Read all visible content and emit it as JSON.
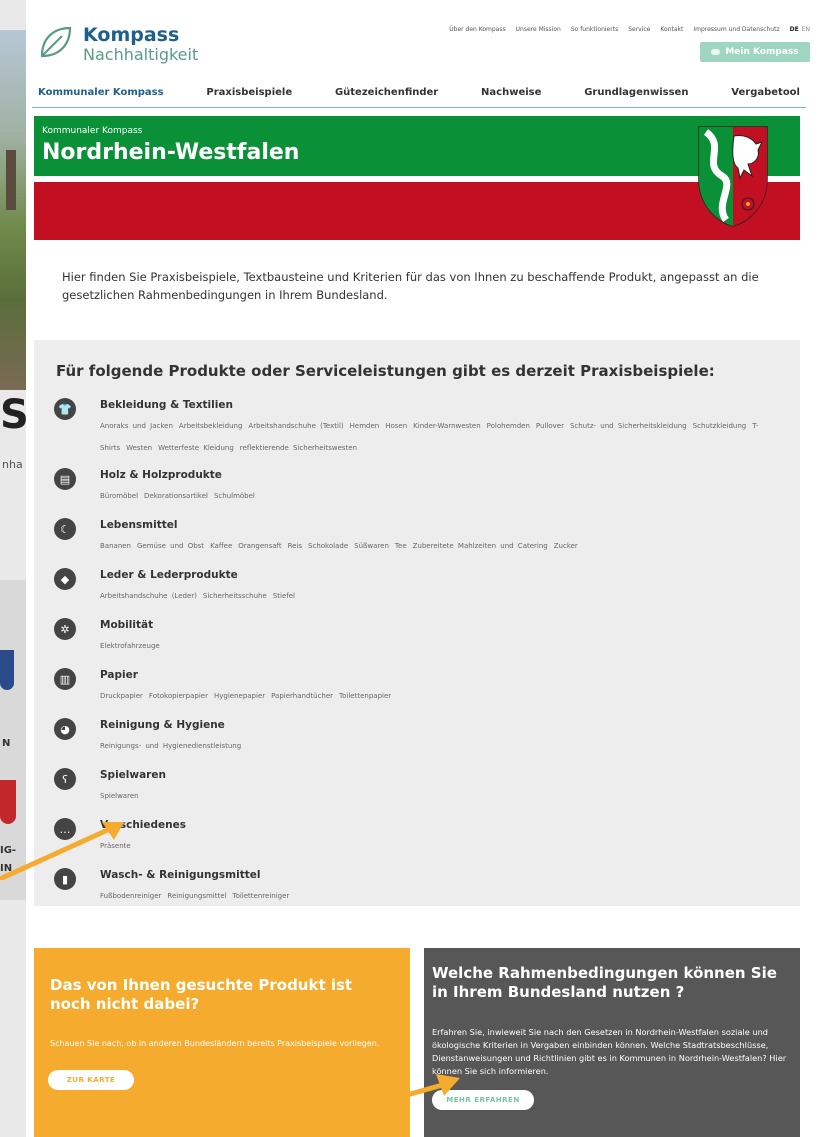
{
  "background": {
    "big_letter": "S",
    "fragment_text": "nha",
    "fragment_n": "N",
    "fragment_ig_1": "IG-",
    "fragment_ig_2": "IN"
  },
  "header": {
    "logo_top": "Kompass",
    "logo_bottom": "Nachhaltigkeit",
    "top_links": [
      "Über den Kompass",
      "Unsere Mission",
      "So funktionierts",
      "Service",
      "Kontakt",
      "Impressum und Datenschutz"
    ],
    "lang_active": "DE",
    "lang_other": "EN",
    "mein_button": "Mein Kompass"
  },
  "nav": {
    "items": [
      "Kommunaler Kompass",
      "Praxisbeispiele",
      "Gütezeichenfinder",
      "Nachweise",
      "Grundlagenwissen",
      "Vergabetool"
    ]
  },
  "hero": {
    "subtitle": "Kommunaler Kompass",
    "title": "Nordrhein-Westfalen"
  },
  "intro": "Hier finden Sie Praxisbeispiele, Textbausteine und Kriterien für das von Ihnen zu beschaffende Produkt, angepasst an die gesetzlichen Rahmenbedingungen in Ihrem Bundesland.",
  "products": {
    "title": "Für folgende Produkte oder Serviceleistungen gibt es derzeit Praxisbeispiele:",
    "categories": [
      {
        "name": "Bekleidung & Textilien",
        "icon": "shirt-icon",
        "items": [
          "Anoraks und Jacken",
          "Arbeitsbekleidung",
          "Arbeitshandschuhe (Textil)",
          "Hemden",
          "Hosen",
          "Kinder-Warnwesten",
          "Polohemden",
          "Pullover",
          "Schutz- und Sicherheitskleidung",
          "Schutzkleidung",
          "T-Shirts",
          "Westen",
          "Wetterfeste Kleidung",
          "reflektierende Sicherheitswesten"
        ]
      },
      {
        "name": "Holz & Holzprodukte",
        "icon": "wood-icon",
        "items": [
          "Büromöbel",
          "Dekorationsartikel",
          "Schulmöbel"
        ]
      },
      {
        "name": "Lebensmittel",
        "icon": "banana-icon",
        "items": [
          "Bananen",
          "Gemüse und Obst",
          "Kaffee",
          "Orangensaft",
          "Reis",
          "Schokolade",
          "Süßwaren",
          "Tee",
          "Zubereitete Mahlzeiten und Catering",
          "Zucker"
        ]
      },
      {
        "name": "Leder & Lederprodukte",
        "icon": "leather-icon",
        "items": [
          "Arbeitshandschuhe (Leder)",
          "Sicherheitsschuhe",
          "Stiefel"
        ]
      },
      {
        "name": "Mobilität",
        "icon": "wheel-icon",
        "items": [
          "Elektrofahrzeuge"
        ]
      },
      {
        "name": "Papier",
        "icon": "paper-icon",
        "items": [
          "Druckpapier",
          "Fotokopierpapier",
          "Hygienepapier",
          "Papierhandtücher",
          "Toilettenpapier"
        ]
      },
      {
        "name": "Reinigung & Hygiene",
        "icon": "cleaning-icon",
        "items": [
          "Reinigungs- und Hygienedienstleistung"
        ]
      },
      {
        "name": "Spielwaren",
        "icon": "teddy-icon",
        "items": [
          "Spielwaren"
        ]
      },
      {
        "name": "Verschiedenes",
        "icon": "more-icon",
        "items": [
          "Präsente"
        ]
      },
      {
        "name": "Wasch- & Reinigungsmittel",
        "icon": "bottle-icon",
        "items": [
          "Fußbodenreiniger",
          "Reinigungsmittel",
          "Toilettenreiniger"
        ]
      }
    ]
  },
  "box_left": {
    "title": "Das von Ihnen gesuchte Produkt ist noch nicht dabei?",
    "text": "Schauen Sie nach, ob in anderen Bundesländern bereits Praxisbeispiele vorliegen.",
    "button": "ZUR KARTE"
  },
  "box_right": {
    "title": "Welche Rahmenbedingungen können Sie in Ihrem Bundesland nutzen ?",
    "text": "Erfahren Sie, inwieweit Sie nach den Gesetzen in Nordrhein-Westfalen soziale und ökologische Kriterien in Vergaben einbinden können. Welche Stadtratsbeschlüsse, Dienstanweisungen und Richtlinien gibt es in Kommunen in Nordrhein-Westfalen? Hier können Sie sich informieren.",
    "button": "MEHR ERFAHREN"
  },
  "colors": {
    "green": "#0a9137",
    "red": "#c30f22",
    "yellow": "#f5ab2d",
    "dark_gray": "#575757",
    "mint": "#9fd6c2",
    "brand_blue": "#1f5f8b",
    "arrow": "#f5ab2d"
  }
}
